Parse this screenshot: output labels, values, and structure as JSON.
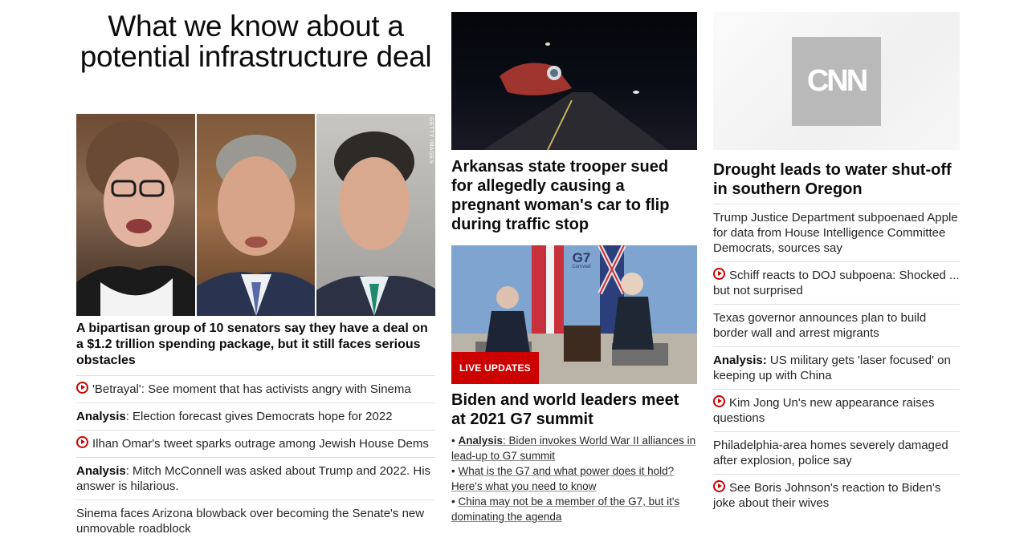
{
  "lead": {
    "headline": "What we know about a potential infrastructure deal",
    "image_credit": "GETTY IMAGES",
    "caption": "A bipartisan group of 10 senators say they have a deal on a $1.2 trillion spending package, but it still faces serious obstacles",
    "items": [
      {
        "prefix": "",
        "text": "'Betrayal': See moment that has activists angry with Sinema",
        "icon": "play-icon"
      },
      {
        "prefix": "Analysis",
        "text": ": Election forecast gives Democrats hope for 2022",
        "icon": ""
      },
      {
        "prefix": "",
        "text": "Ilhan Omar's tweet sparks outrage among Jewish House Dems",
        "icon": "play-icon"
      },
      {
        "prefix": "Analysis",
        "text": ": Mitch McConnell was asked about Trump and 2022. His answer is hilarious.",
        "icon": ""
      },
      {
        "prefix": "",
        "text": "Sinema faces Arizona blowback over becoming the Senate's new unmovable roadblock",
        "icon": ""
      }
    ]
  },
  "middle": {
    "story1_headline": "Arkansas state trooper sued for allegedly causing a pregnant woman's car to flip during traffic stop",
    "story2_badge": "LIVE UPDATES",
    "story2_headline": "Biden and world leaders meet at 2021 G7 summit",
    "g7_sign": "G7",
    "g7_sign_sub": "Cornwall",
    "bullets": [
      {
        "prefix": "Analysis",
        "text": ": Biden invokes World War II alliances in lead-up to G7 summit"
      },
      {
        "prefix": "",
        "text": "What is the G7 and what power does it hold? Here's what you need to know"
      },
      {
        "prefix": "",
        "text": "China may not be a member of the G7, but it's dominating the agenda"
      }
    ]
  },
  "right": {
    "logo_text": "CNN",
    "headline": "Drought leads to water shut-off in southern Oregon",
    "items": [
      {
        "prefix": "",
        "text": "Trump Justice Department subpoenaed Apple for data from House Intelligence Committee Democrats, sources say",
        "icon": ""
      },
      {
        "prefix": "",
        "text": "Schiff reacts to DOJ subpoena: Shocked ... but not surprised",
        "icon": "play-icon"
      },
      {
        "prefix": "",
        "text": "Texas governor announces plan to build border wall and arrest migrants",
        "icon": ""
      },
      {
        "prefix": "Analysis:",
        "text": " US military gets 'laser focused' on keeping up with China",
        "icon": ""
      },
      {
        "prefix": "",
        "text": "Kim Jong Un's new appearance raises questions",
        "icon": "play-icon"
      },
      {
        "prefix": "",
        "text": "Philadelphia-area homes severely damaged after explosion, police say",
        "icon": ""
      },
      {
        "prefix": "",
        "text": "See Boris Johnson's reaction to Biden's joke about their wives",
        "icon": "play-icon"
      }
    ]
  },
  "colors": {
    "accent_red": "#cc0000",
    "text": "#262626",
    "divider": "#dedede"
  }
}
